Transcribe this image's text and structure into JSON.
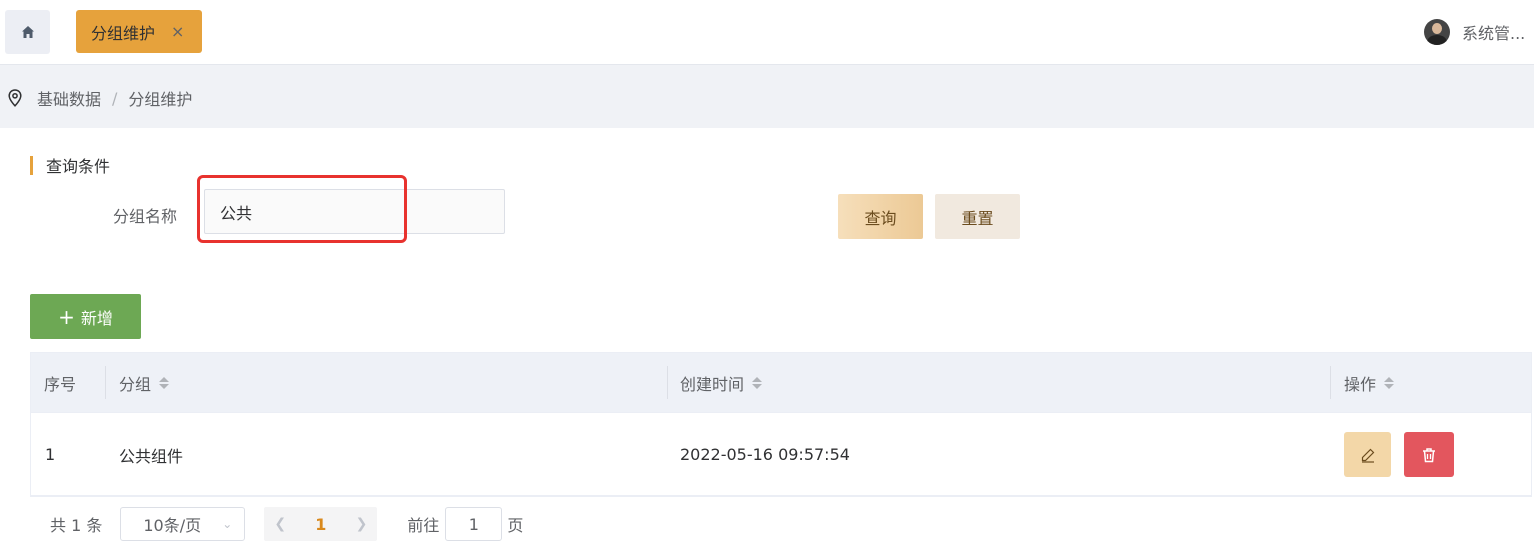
{
  "header": {
    "tab_label": "分组维护",
    "tab_close": "×",
    "user_name": "系统管..."
  },
  "breadcrumb": {
    "items": [
      "基础数据",
      "分组维护"
    ],
    "separator": "/"
  },
  "query": {
    "section_title": "查询条件",
    "field_label": "分组名称",
    "field_value": "公共",
    "query_button": "查询",
    "reset_button": "重置"
  },
  "add_button": "新增",
  "table": {
    "columns": [
      "序号",
      "分组",
      "创建时间",
      "操作"
    ],
    "rows": [
      {
        "index": "1",
        "group": "公共组件",
        "created": "2022-05-16 09:57:54"
      }
    ]
  },
  "pagination": {
    "total": "共 1 条",
    "page_size": "10条/页",
    "current_page": "1",
    "goto_label": "前往",
    "goto_value": "1",
    "page_unit": "页"
  },
  "colors": {
    "accent": "#e6a23c",
    "add": "#6da854",
    "danger": "#e3565e",
    "highlight": "#e8322e"
  }
}
